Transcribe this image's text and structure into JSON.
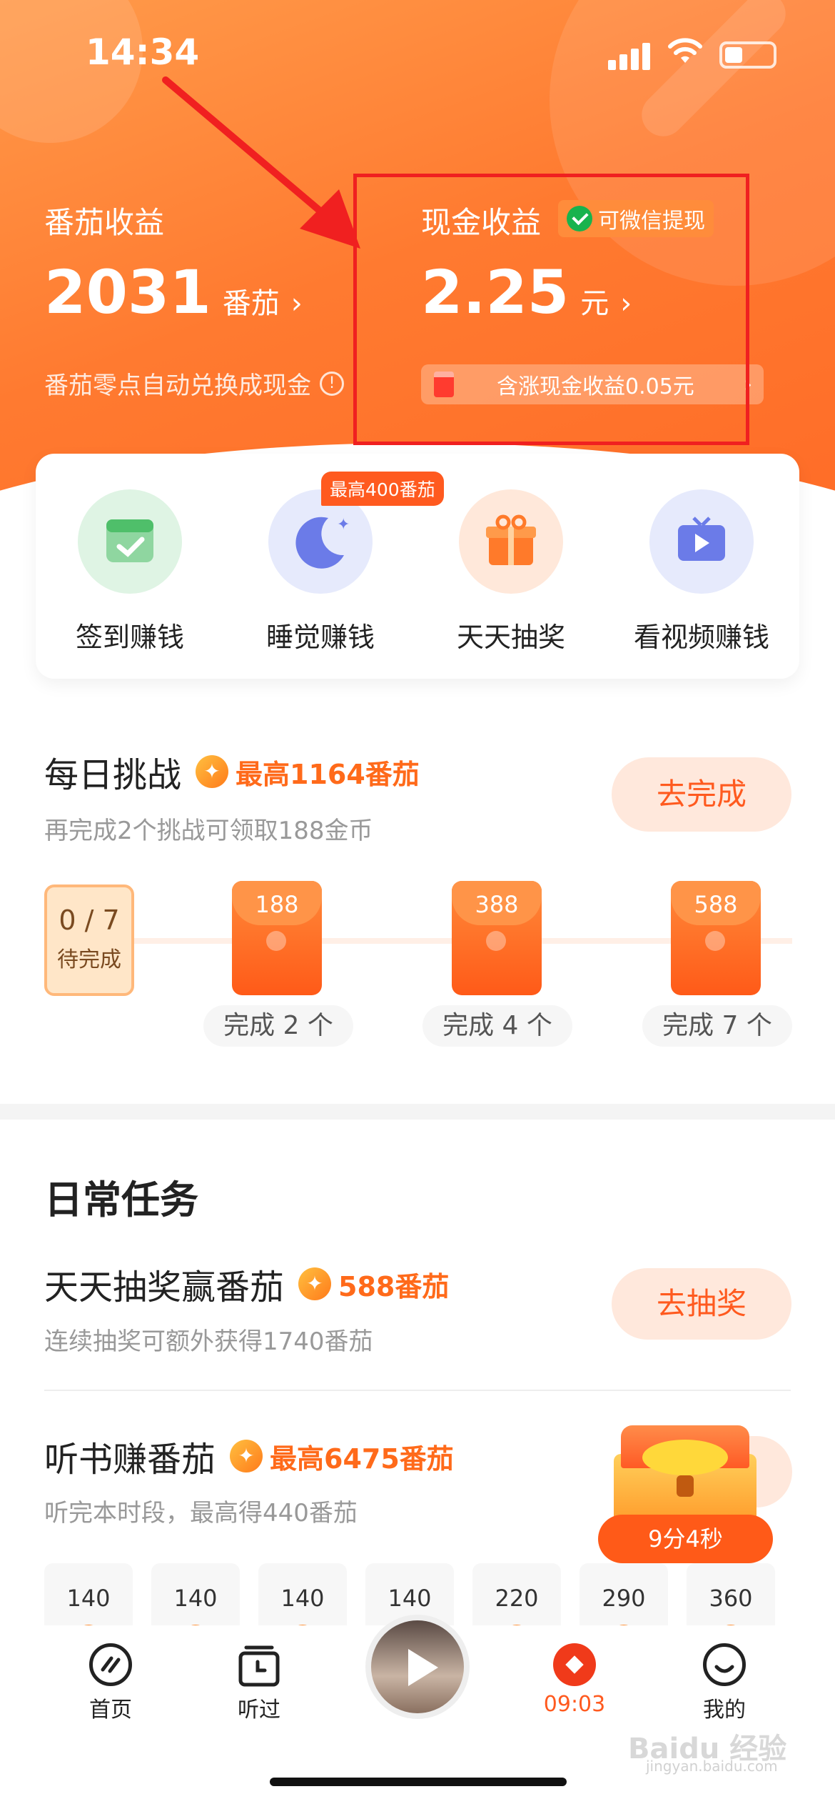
{
  "status_bar": {
    "time": "14:34"
  },
  "earnings": {
    "tomato": {
      "label": "番茄收益",
      "value": "2031",
      "unit": "番茄",
      "note": "番茄零点自动兑换成现金"
    },
    "cash": {
      "label": "现金收益",
      "badge": "可微信提现",
      "value": "2.25",
      "unit": "元",
      "sub_note": "含涨现金收益0.05元"
    }
  },
  "quick_actions": {
    "badge": "最高400番茄",
    "items": [
      {
        "label": "签到赚钱",
        "icon": "calendar-check-icon",
        "color": "#e6f7ea"
      },
      {
        "label": "睡觉赚钱",
        "icon": "moon-icon",
        "color": "#e9ecfd"
      },
      {
        "label": "天天抽奖",
        "icon": "gift-icon",
        "color": "#ffece0"
      },
      {
        "label": "看视频赚钱",
        "icon": "tv-icon",
        "color": "#e9ecfd"
      }
    ]
  },
  "daily_challenge": {
    "title": "每日挑战",
    "reward": "最高1164番茄",
    "subtitle": "再完成2个挑战可领取188金币",
    "button": "去完成",
    "progress": {
      "count": "0 / 7",
      "status": "待完成"
    },
    "milestones": [
      {
        "amount": "188",
        "caption": "完成 2 个"
      },
      {
        "amount": "388",
        "caption": "完成 4 个"
      },
      {
        "amount": "588",
        "caption": "完成 7 个"
      }
    ]
  },
  "daily_tasks": {
    "title": "日常任务",
    "tasks": [
      {
        "title": "天天抽奖赢番茄",
        "reward": "588番茄",
        "subtitle": "连续抽奖可额外获得1740番茄",
        "button": "去抽奖"
      },
      {
        "title": "听书赚番茄",
        "reward": "最高6475番茄",
        "subtitle": "听完本时段，最高得440番茄",
        "button": ""
      }
    ],
    "hour_rewards": [
      "140",
      "140",
      "140",
      "140",
      "220",
      "290",
      "360"
    ],
    "chest_timer": "9分4秒"
  },
  "tab_bar": {
    "items": [
      {
        "label": "首页",
        "icon": "home-icon"
      },
      {
        "label": "听过",
        "icon": "history-icon"
      },
      {
        "label": "",
        "icon": "player-avatar"
      },
      {
        "label": "09:03",
        "icon": "red-packet-icon"
      },
      {
        "label": "我的",
        "icon": "profile-smile-icon"
      }
    ]
  },
  "watermark": {
    "text": "Baidu 经验",
    "sub": "jingyan.baidu.com"
  }
}
